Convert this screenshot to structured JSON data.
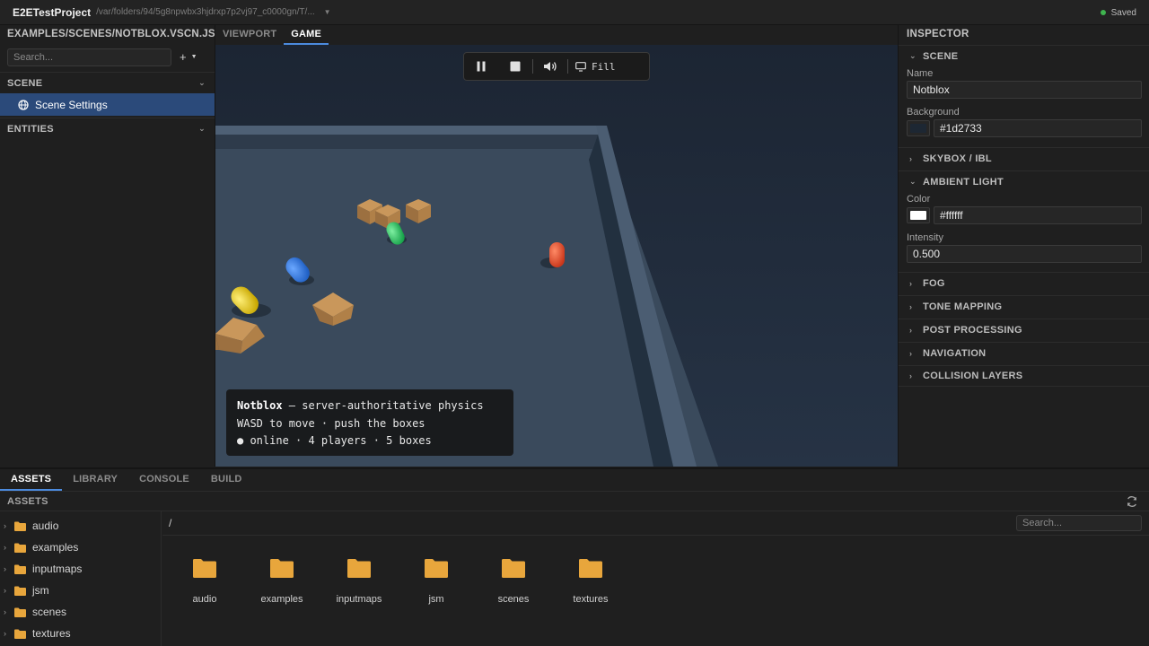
{
  "app": {
    "title": "E2ETestProject",
    "path": "/var/folders/94/5g8npwbx3hjdrxp7p2vj97_c0000gn/T/...",
    "status": "Saved",
    "status_color": "#3fb44f"
  },
  "left_panel": {
    "scene_path": "EXAMPLES/SCENES/NOTBLOX.VSCN.JSON",
    "search_placeholder": "Search...",
    "scene_section": "SCENE",
    "scene_settings": "Scene Settings",
    "entities_section": "ENTITIES"
  },
  "view_tabs": [
    "VIEWPORT",
    "GAME"
  ],
  "game_toolbar": {
    "fill_label": "Fill"
  },
  "hud": {
    "title": "Notblox",
    "title_rest": " — server-authoritative physics",
    "line2": "WASD to move · push the boxes",
    "line3": "● online · 4 players · 5 boxes"
  },
  "inspector": {
    "header": "INSPECTOR",
    "scene_section": "SCENE",
    "name_label": "Name",
    "name_value": "Notblox",
    "background_label": "Background",
    "background_value": "#1d2733",
    "skybox_section": "SKYBOX / IBL",
    "ambient_section": "AMBIENT LIGHT",
    "color_label": "Color",
    "color_value": "#ffffff",
    "intensity_label": "Intensity",
    "intensity_value": "0.500",
    "collapsed_sections": [
      "FOG",
      "TONE MAPPING",
      "POST PROCESSING",
      "NAVIGATION",
      "COLLISION LAYERS"
    ]
  },
  "bottom_tabs": [
    "ASSETS",
    "LIBRARY",
    "CONSOLE",
    "BUILD"
  ],
  "assets": {
    "header": "ASSETS",
    "crumb": "/",
    "search_placeholder": "Search...",
    "tree": [
      "audio",
      "examples",
      "inputmaps",
      "jsm",
      "scenes",
      "textures"
    ],
    "folders": [
      "audio",
      "examples",
      "inputmaps",
      "jsm",
      "scenes",
      "textures"
    ],
    "folder_color": "#e8a63c"
  }
}
